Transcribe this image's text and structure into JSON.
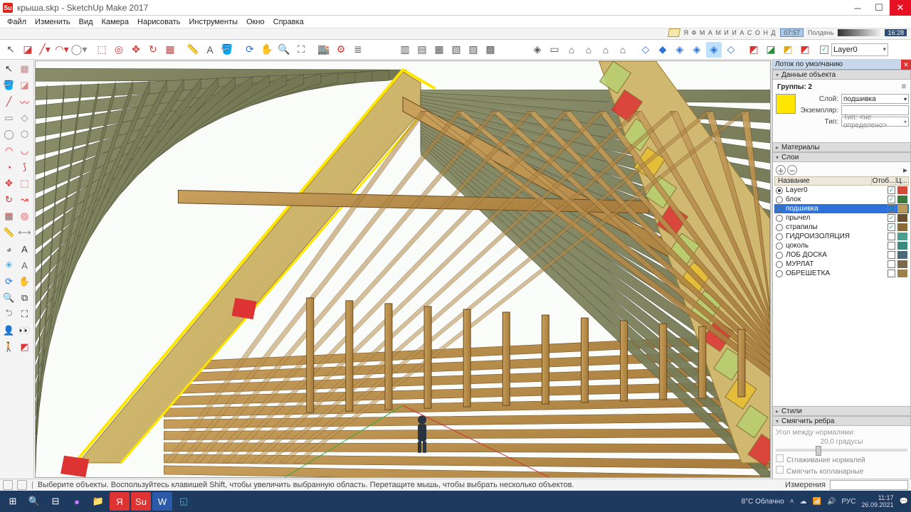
{
  "title": "крыша.skp - SketchUp Make 2017",
  "menu": [
    "Файл",
    "Изменить",
    "Вид",
    "Камера",
    "Нарисовать",
    "Инструменты",
    "Окно",
    "Справка"
  ],
  "timeline": {
    "months": "Я Ф М А М И И А С О Н Д",
    "time": "07:57",
    "noon": "Полдень",
    "end": "16:28"
  },
  "layer_dd": "Layer0",
  "tray": {
    "title": "Лоток по умолчанию",
    "entity": {
      "header": "Данные объекта",
      "group": "Группы: 2",
      "layer_lbl": "Слой:",
      "layer": "подшивка",
      "instance_lbl": "Экземпляр:",
      "instance": "",
      "type_lbl": "Тип:",
      "type": "Тип: <не определено>"
    },
    "materials": "Материалы",
    "styles": "Стили",
    "soften": {
      "header": "Смягчить ребра",
      "angle_lbl": "Угол между нормалями:",
      "angle": "20,0",
      "unit": "градусы",
      "smooth": "Сглаживание нормалей",
      "coplanar": "Смягчить копланарные"
    },
    "layers": {
      "header": "Слои",
      "col_name": "Название",
      "col_vis": "Отоб...",
      "col_c": "Ц...",
      "rows": [
        {
          "name": "Layer0",
          "on": true,
          "vis": true,
          "color": "#d44a3a"
        },
        {
          "name": "блок",
          "on": false,
          "vis": true,
          "color": "#3a7a3a"
        },
        {
          "name": "подшивка",
          "on": false,
          "vis": true,
          "color": "#b89a5a",
          "sel": true
        },
        {
          "name": "прычел",
          "on": false,
          "vis": true,
          "color": "#6a5030"
        },
        {
          "name": "страпилы",
          "on": false,
          "vis": true,
          "color": "#8a6a3a"
        },
        {
          "name": "ГИДРОИЗОЛЯЦИЯ",
          "on": false,
          "vis": false,
          "color": "#4aa090"
        },
        {
          "name": "цоколь",
          "on": false,
          "vis": false,
          "color": "#3a8a80"
        },
        {
          "name": "ЛОБ ДОСКА",
          "on": false,
          "vis": false,
          "color": "#4a6a7a"
        },
        {
          "name": "МУРЛАТ",
          "on": false,
          "vis": false,
          "color": "#7a6a50"
        },
        {
          "name": "ОБРЕШЕТКА",
          "on": false,
          "vis": false,
          "color": "#a0804a"
        }
      ]
    }
  },
  "status": {
    "hint": "Выберите объекты. Воспользуйтесь клавишей Shift, чтобы увеличить выбранную область. Перетащите мышь, чтобы выбрать несколько объектов.",
    "meas": "Измерения"
  },
  "taskbar": {
    "weather": "8°C  Облачно",
    "lang": "РУС",
    "time": "11:17",
    "date": "26.09.2021"
  }
}
